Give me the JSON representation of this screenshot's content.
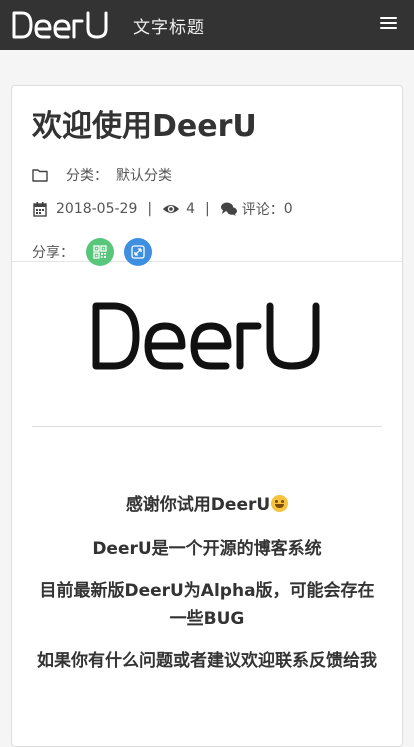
{
  "navbar": {
    "brand": "DeerU",
    "site_title": "文字标题",
    "menu_icon": "hamburger-menu-icon"
  },
  "post": {
    "title": "欢迎使用DeerU",
    "category_label": "分类：",
    "category_value": "默认分类",
    "date": "2018-05-29",
    "sep1": "|",
    "views": "4",
    "sep2": "|",
    "comments_label": "评论：",
    "comments_value": "0",
    "share_label": "分享："
  },
  "content": {
    "logo_text": "DeerU",
    "p1": "感谢你试用DeerU",
    "p2": "DeerU是一个开源的博客系统",
    "p3": "目前最新版DeerU为Alpha版，可能会存在一些BUG",
    "p4": "如果你有什么问题或者建议欢迎联系反馈给我"
  },
  "colors": {
    "navbar_bg": "#333333",
    "share_wechat": "#58c77c",
    "share_link": "#3e8fe0"
  },
  "icons": [
    "folder-icon",
    "calendar-icon",
    "eye-icon",
    "comments-icon",
    "wechat-qr-icon",
    "link-icon",
    "grinning-emoji-icon"
  ]
}
